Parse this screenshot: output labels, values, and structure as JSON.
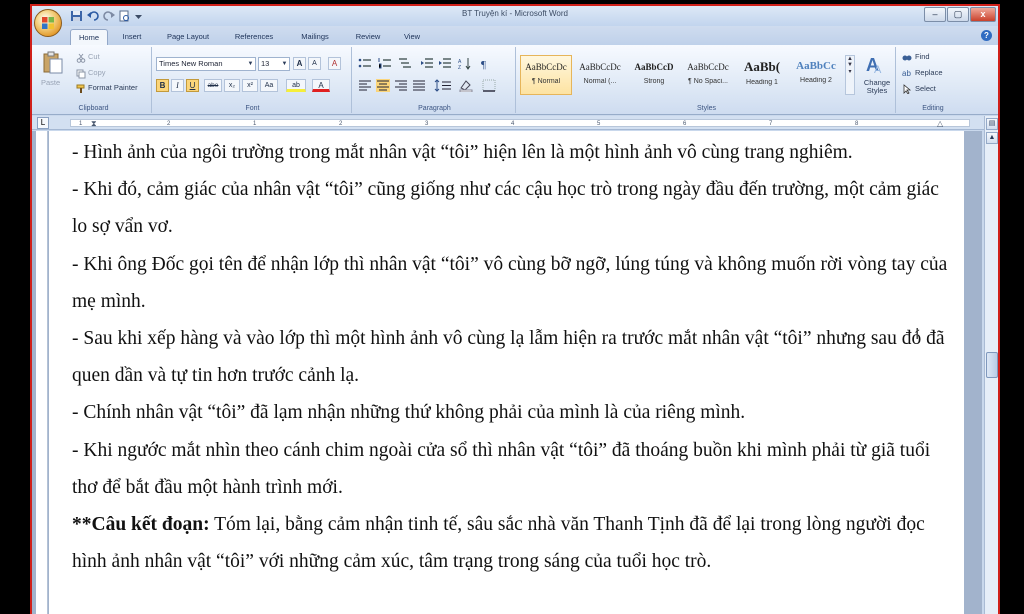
{
  "window": {
    "title": "BT Truyện kí - Microsoft Word",
    "min_glyph": "–",
    "max_glyph": "▢",
    "close_glyph": "x"
  },
  "tabs": [
    "Home",
    "Insert",
    "Page Layout",
    "References",
    "Mailings",
    "Review",
    "View"
  ],
  "help_glyph": "?",
  "ribbon": {
    "clipboard": {
      "label": "Clipboard",
      "paste": "Paste",
      "cut": "Cut",
      "copy": "Copy",
      "format_painter": "Format Painter"
    },
    "font": {
      "label": "Font",
      "font_name": "Times New Roman",
      "font_size": "13",
      "grow": "A",
      "shrink": "A",
      "clear": "A",
      "bold": "B",
      "italic": "I",
      "underline": "U",
      "strike": "abe",
      "subscript": "x₂",
      "superscript": "x²",
      "change_case": "Aa",
      "highlight": "ab",
      "font_color": "A"
    },
    "paragraph": {
      "label": "Paragraph"
    },
    "styles": {
      "label": "Styles",
      "items": [
        {
          "sample": "AaBbCcDc",
          "name": "¶ Normal"
        },
        {
          "sample": "AaBbCcDc",
          "name": "Normal (..."
        },
        {
          "sample": "AaBbCcD",
          "name": "Strong"
        },
        {
          "sample": "AaBbCcDc",
          "name": "¶ No Spaci..."
        },
        {
          "sample": "AaBb(",
          "name": "Heading 1"
        },
        {
          "sample": "AaBbCc",
          "name": "Heading 2"
        }
      ],
      "change_styles": "Change Styles"
    },
    "editing": {
      "label": "Editing",
      "find": "Find",
      "replace": "Replace",
      "select": "Select"
    }
  },
  "ruler_numbers": [
    "1",
    "2",
    "1",
    "2",
    "3",
    "4",
    "5",
    "6",
    "7"
  ],
  "ruler_numbers_extra": [
    "8"
  ],
  "tab_selector": "L",
  "document": {
    "paragraphs": [
      "- Hình ảnh của ngôi trường trong mắt nhân vật “tôi” hiện lên là một hình ảnh vô cùng trang nghiêm.",
      "- Khi đó, cảm giác của nhân vật “tôi” cũng giống như các cậu học trò trong ngày đầu đến trường, một cảm giác lo sợ  vẩn vơ.",
      "- Khi ông Đốc gọi tên để nhận lớp thì nhân vật “tôi” vô cùng bỡ ngỡ, lúng túng và không muốn rời vòng tay của mẹ mình.",
      "- Sau khi xếp hàng và vào lớp thì một hình ảnh vô cùng lạ lẫm hiện ra trước mắt nhân vật “tôi” nhưng sau đó đã quen dần và tự tin hơn trước cảnh lạ.",
      "- Chính nhân vật “tôi” đã lạm nhận những thứ không phải của mình là của riêng mình.",
      "- Khi ngước mắt nhìn theo cánh chim ngoài cửa sổ thì nhân vật “tôi” đã thoáng buồn khi mình phải từ giã tuổi thơ để bắt đầu một hành trình mới."
    ],
    "conclusion_label": "**Câu kết đoạn:",
    "conclusion_text": " Tóm lại, bằng cảm nhận tinh tế, sâu sắc nhà văn Thanh Tịnh đã để lại trong lòng người đọc hình ảnh nhân vật “tôi” với những cảm xúc, tâm trạng trong sáng của tuổi học trò.",
    "cursor_glyph": "I"
  },
  "colors": {
    "window_border": "#d0201a",
    "ribbon_bg": "#dfe9f6",
    "style_selected": "#fde3a2",
    "page_bg": "#ffffff",
    "text": "#111111"
  }
}
